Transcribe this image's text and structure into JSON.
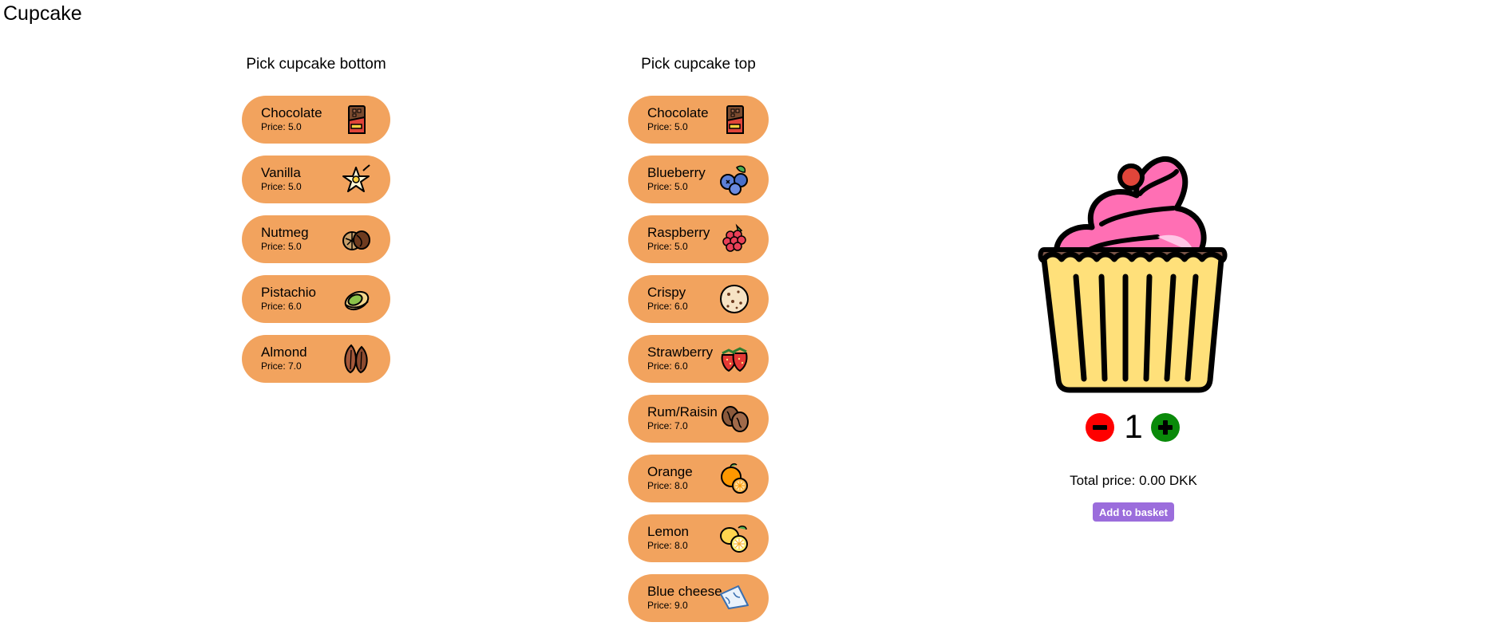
{
  "app": {
    "title": "Cupcake"
  },
  "bottoms": {
    "heading": "Pick cupcake bottom",
    "items": [
      {
        "name": "Chocolate",
        "price": "Price: 5.0",
        "icon": "chocolate-bar-icon"
      },
      {
        "name": "Vanilla",
        "price": "Price: 5.0",
        "icon": "vanilla-flower-icon"
      },
      {
        "name": "Nutmeg",
        "price": "Price: 5.0",
        "icon": "nutmeg-icon"
      },
      {
        "name": "Pistachio",
        "price": "Price: 6.0",
        "icon": "pistachio-icon"
      },
      {
        "name": "Almond",
        "price": "Price: 7.0",
        "icon": "almond-icon"
      }
    ]
  },
  "tops": {
    "heading": "Pick cupcake top",
    "items": [
      {
        "name": "Chocolate",
        "price": "Price: 5.0",
        "icon": "chocolate-bar-icon"
      },
      {
        "name": "Blueberry",
        "price": "Price: 5.0",
        "icon": "blueberry-icon"
      },
      {
        "name": "Raspberry",
        "price": "Price: 5.0",
        "icon": "raspberry-icon"
      },
      {
        "name": "Crispy",
        "price": "Price: 6.0",
        "icon": "cookie-icon"
      },
      {
        "name": "Strawberry",
        "price": "Price: 6.0",
        "icon": "strawberry-icon"
      },
      {
        "name": "Rum/Raisin",
        "price": "Price: 7.0",
        "icon": "raisin-icon"
      },
      {
        "name": "Orange",
        "price": "Price: 8.0",
        "icon": "orange-icon"
      },
      {
        "name": "Lemon",
        "price": "Price: 8.0",
        "icon": "lemon-icon"
      },
      {
        "name": "Blue cheese",
        "price": "Price: 9.0",
        "icon": "cheese-icon"
      }
    ]
  },
  "preview": {
    "icon": "cupcake-icon"
  },
  "order": {
    "quantity": "1",
    "minus_icon": "minus-icon",
    "plus_icon": "plus-icon",
    "total_label": "Total price: 0.00 DKK",
    "add_label": "Add to basket"
  },
  "colors": {
    "button_bg": "#f2a35e",
    "minus": "#ff0000",
    "plus": "#0a8a0a",
    "add_button": "#9b6ddc"
  }
}
